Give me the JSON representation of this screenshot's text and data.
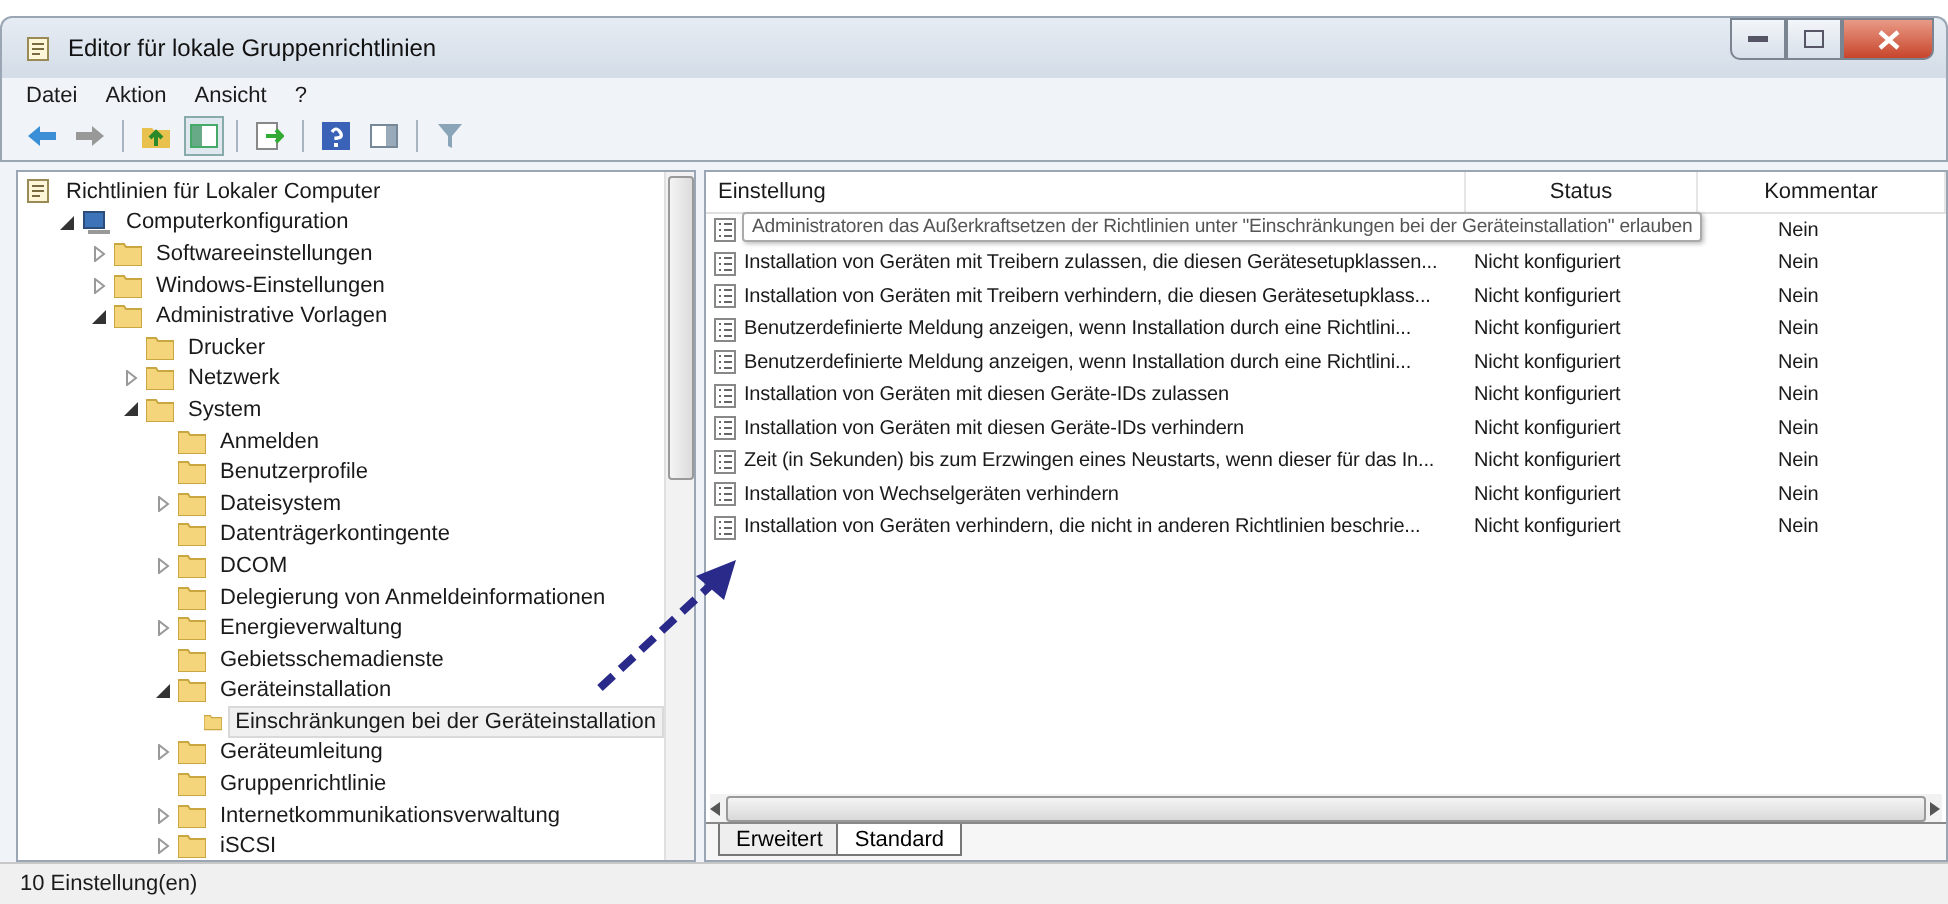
{
  "window": {
    "title": "Editor für lokale Gruppenrichtlinien"
  },
  "menu": [
    "Datei",
    "Aktion",
    "Ansicht",
    "?"
  ],
  "tree": [
    {
      "label": "Richtlinien für Lokaler Computer",
      "kind": "policy",
      "selected": false,
      "children": [
        {
          "label": "Computerkonfiguration",
          "kind": "computer",
          "expanded": true,
          "selected": false,
          "children": [
            {
              "label": "Softwareeinstellungen",
              "kind": "folder",
              "expanded": false,
              "selected": false
            },
            {
              "label": "Windows-Einstellungen",
              "kind": "folder",
              "expanded": false,
              "selected": false
            },
            {
              "label": "Administrative Vorlagen",
              "kind": "folder",
              "expanded": true,
              "selected": false,
              "children": [
                {
                  "label": "Drucker",
                  "kind": "folder",
                  "selected": false
                },
                {
                  "label": "Netzwerk",
                  "kind": "folder",
                  "expanded": false,
                  "selected": false
                },
                {
                  "label": "System",
                  "kind": "folder",
                  "expanded": true,
                  "selected": false,
                  "children": [
                    {
                      "label": "Anmelden",
                      "kind": "folder",
                      "selected": false
                    },
                    {
                      "label": "Benutzerprofile",
                      "kind": "folder",
                      "selected": false
                    },
                    {
                      "label": "Dateisystem",
                      "kind": "folder",
                      "expanded": false,
                      "selected": false
                    },
                    {
                      "label": "Datenträgerkontingente",
                      "kind": "folder",
                      "selected": false
                    },
                    {
                      "label": "DCOM",
                      "kind": "folder",
                      "expanded": false,
                      "selected": false
                    },
                    {
                      "label": "Delegierung von Anmeldeinformationen",
                      "kind": "folder",
                      "selected": false
                    },
                    {
                      "label": "Energieverwaltung",
                      "kind": "folder",
                      "expanded": false,
                      "selected": false
                    },
                    {
                      "label": "Gebietsschemadienste",
                      "kind": "folder",
                      "selected": false
                    },
                    {
                      "label": "Geräteinstallation",
                      "kind": "folder",
                      "expanded": true,
                      "selected": false,
                      "children": [
                        {
                          "label": "Einschränkungen bei der Geräteinstallation",
                          "kind": "folder",
                          "selected": true
                        }
                      ]
                    },
                    {
                      "label": "Geräteumleitung",
                      "kind": "folder",
                      "expanded": false,
                      "selected": false
                    },
                    {
                      "label": "Gruppenrichtlinie",
                      "kind": "folder",
                      "selected": false
                    },
                    {
                      "label": "Internetkommunikationsverwaltung",
                      "kind": "folder",
                      "expanded": false,
                      "selected": false
                    },
                    {
                      "label": "iSCSI",
                      "kind": "folder",
                      "expanded": false,
                      "selected": false
                    }
                  ]
                }
              ]
            }
          ]
        }
      ]
    }
  ],
  "table": {
    "columns": [
      "Einstellung",
      "Status",
      "Kommentar"
    ],
    "rows": [
      {
        "setting": "Administratoren das Außerkraftsetzen der Richtlinien unter \"Einschränkungen bei der Geräteinstallation\" erlauben",
        "comment": "Nein",
        "tooltip": true
      },
      {
        "setting": "Installation von Geräten mit Treibern zulassen, die diesen Gerätesetupklassen...",
        "status": "Nicht konfiguriert",
        "comment": "Nein",
        "tooltip": false
      },
      {
        "setting": "Installation von Geräten mit Treibern verhindern, die diesen Gerätesetupklass...",
        "status": "Nicht konfiguriert",
        "comment": "Nein",
        "tooltip": false
      },
      {
        "setting": "Benutzerdefinierte Meldung anzeigen, wenn Installation durch eine Richtlini...",
        "status": "Nicht konfiguriert",
        "comment": "Nein",
        "tooltip": false
      },
      {
        "setting": "Benutzerdefinierte Meldung anzeigen, wenn Installation durch eine Richtlini...",
        "status": "Nicht konfiguriert",
        "comment": "Nein",
        "tooltip": false
      },
      {
        "setting": "Installation von Geräten mit diesen Geräte-IDs zulassen",
        "status": "Nicht konfiguriert",
        "comment": "Nein",
        "tooltip": false
      },
      {
        "setting": "Installation von Geräten mit diesen Geräte-IDs verhindern",
        "status": "Nicht konfiguriert",
        "comment": "Nein",
        "tooltip": false
      },
      {
        "setting": "Zeit (in Sekunden) bis zum Erzwingen eines Neustarts, wenn dieser für das In...",
        "status": "Nicht konfiguriert",
        "comment": "Nein",
        "tooltip": false
      },
      {
        "setting": "Installation von Wechselgeräten verhindern",
        "status": "Nicht konfiguriert",
        "comment": "Nein",
        "tooltip": false
      },
      {
        "setting": "Installation von Geräten verhindern, die nicht in anderen Richtlinien beschrie...",
        "status": "Nicht konfiguriert",
        "comment": "Nein",
        "tooltip": false
      }
    ]
  },
  "view_tabs": [
    {
      "label": "Erweitert",
      "selected": false
    },
    {
      "label": "Standard",
      "selected": true
    }
  ],
  "status_bar": "10 Einstellung(en)"
}
